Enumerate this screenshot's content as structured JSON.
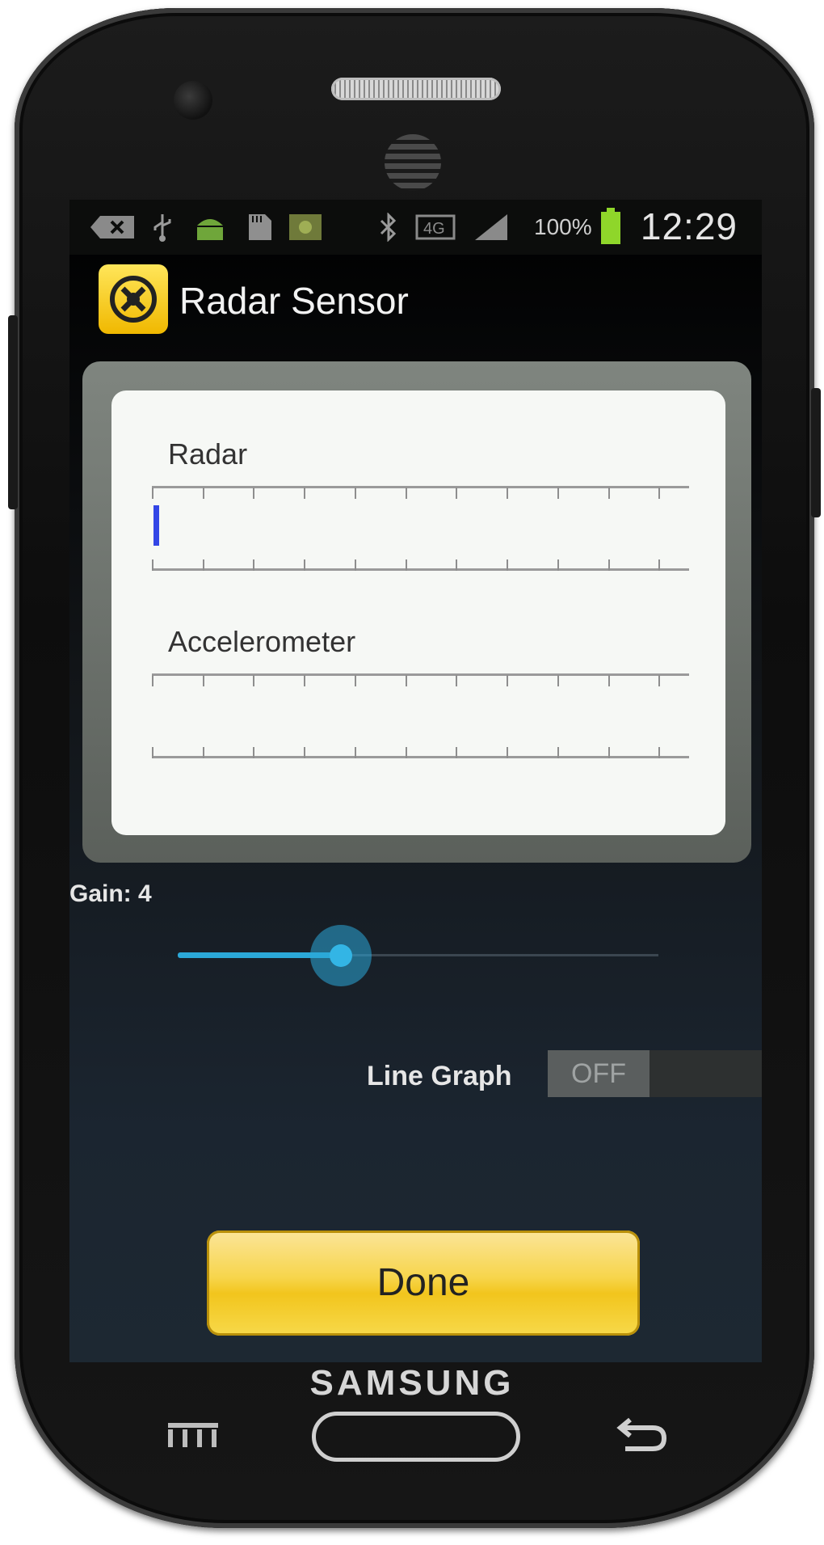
{
  "status_bar": {
    "time": "12:29",
    "battery_percent": "100%",
    "icons": [
      "notification-icon",
      "usb-icon",
      "android-icon",
      "sd-card-icon",
      "gallery-icon",
      "bluetooth-icon",
      "network-4g-icon",
      "signal-icon",
      "battery-icon"
    ]
  },
  "app": {
    "title": "Radar Sensor",
    "icon": "radar-app-icon"
  },
  "meters": {
    "radar_label": "Radar",
    "accelerometer_label": "Accelerometer"
  },
  "gain": {
    "label": "Gain: 4",
    "value": 4,
    "fill_fraction": 0.34
  },
  "line_graph": {
    "label": "Line Graph",
    "state": "OFF"
  },
  "done_button": {
    "label": "Done"
  },
  "device": {
    "brand": "SAMSUNG"
  },
  "colors": {
    "accent": "#33b5e5",
    "done_button": "#f7d54b",
    "radar_bar": "#3346e6"
  }
}
